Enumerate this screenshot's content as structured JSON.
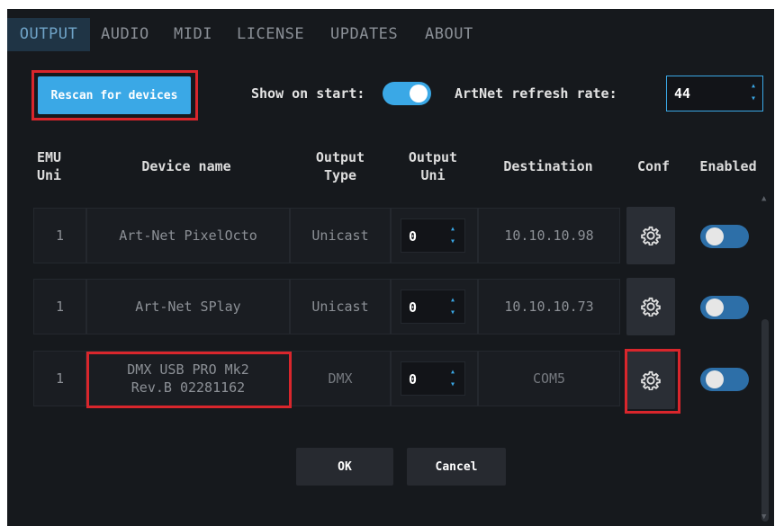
{
  "tabs": [
    {
      "label": "OUTPUT",
      "active": true
    },
    {
      "label": "AUDIO",
      "active": false
    },
    {
      "label": "MIDI",
      "active": false
    },
    {
      "label": "LICENSE",
      "active": false
    },
    {
      "label": "UPDATES",
      "active": false
    },
    {
      "label": "ABOUT",
      "active": false
    }
  ],
  "controls": {
    "rescan_label": "Rescan for devices",
    "show_on_start_label": "Show on start:",
    "show_on_start": true,
    "refresh_rate_label": "ArtNet refresh rate:",
    "refresh_rate_value": "44"
  },
  "table": {
    "headers": {
      "emu_uni_line1": "EMU",
      "emu_uni_line2": "Uni",
      "device_name": "Device name",
      "output_type_line1": "Output",
      "output_type_line2": "Type",
      "output_uni_line1": "Output",
      "output_uni_line2": "Uni",
      "destination": "Destination",
      "conf": "Conf",
      "enabled": "Enabled"
    },
    "rows": [
      {
        "emu_uni": "1",
        "device_name_line1": "Art-Net PixelOcto",
        "device_name_line2": "",
        "output_type": "Unicast",
        "output_uni": "0",
        "destination": "10.10.10.98",
        "enabled": false
      },
      {
        "emu_uni": "1",
        "device_name_line1": "Art-Net SPlay",
        "device_name_line2": "",
        "output_type": "Unicast",
        "output_uni": "0",
        "destination": "10.10.10.73",
        "enabled": false
      },
      {
        "emu_uni": "1",
        "device_name_line1": "DMX USB PRO Mk2",
        "device_name_line2": "Rev.B 02281162",
        "output_type": "DMX",
        "output_uni": "0",
        "destination": "COM5",
        "enabled": false
      }
    ]
  },
  "footer": {
    "ok_label": "OK",
    "cancel_label": "Cancel"
  },
  "colors": {
    "accent": "#3aa8e6",
    "highlight": "#d9262c",
    "background": "#16191d"
  }
}
